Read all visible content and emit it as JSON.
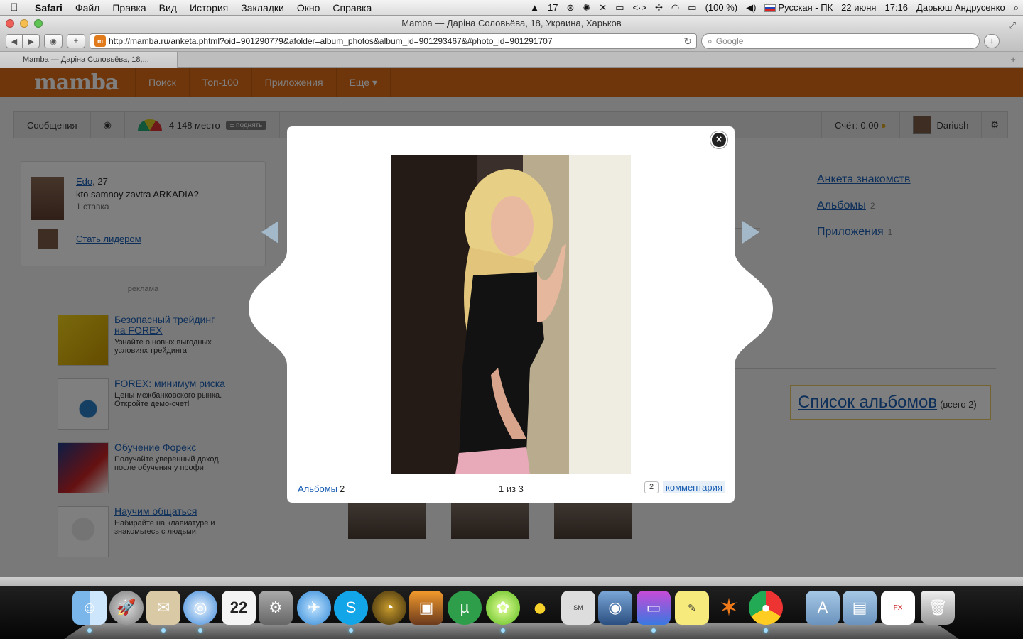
{
  "menubar": {
    "app": "Safari",
    "items": [
      "Файл",
      "Правка",
      "Вид",
      "История",
      "Закладки",
      "Окно",
      "Справка"
    ],
    "status": {
      "calendar_badge": "17",
      "battery": "(100 %)",
      "input_source": "Русская - ПК",
      "date": "22 июня",
      "time": "17:16",
      "user": "Дарьюш Андрусенко"
    }
  },
  "window": {
    "title": "Mamba — Даріна Соловьёва, 18, Украина, Харьков",
    "url": "http://mamba.ru/anketa.phtml?oid=901290779&afolder=album_photos&album_id=901293467&#photo_id=901291707",
    "search_placeholder": "Google",
    "tab_title": "Mamba — Даріна Соловьёва, 18,..."
  },
  "site": {
    "logo": "mamba",
    "nav": [
      "Поиск",
      "Топ-100",
      "Приложения",
      "Еще ▾"
    ],
    "userbar": {
      "messages": "Сообщения",
      "rank": "4 148 место",
      "raise": "± поднять",
      "balance": "Счёт: 0.00",
      "username": "Dariush"
    },
    "leader": {
      "name": "Edo",
      "age": ", 27",
      "text": "kto samnoy zavtra ARKADİA?",
      "bets": "1 ставка",
      "cta": "Стать лидером"
    },
    "ads_label": "реклама",
    "ads": [
      {
        "title": "Безопасный трейдинг на FOREX",
        "desc": "Узнайте о новых выгодных условиях трейдинга"
      },
      {
        "title": "FOREX: минимум риска",
        "desc": "Цены межбанковского рынка. Откройте демо-счет!"
      },
      {
        "title": "Обучение Форекс",
        "desc": "Получайте уверенный доход после обучения у профи"
      },
      {
        "title": "Научим общаться",
        "desc": "Набирайте на клавиатуре и знакомьтесь с людьми."
      }
    ],
    "right_links": [
      {
        "label": "Анкета знакомств",
        "count": ""
      },
      {
        "label": "Альбомы",
        "count": "2"
      },
      {
        "label": "Приложения",
        "count": "1"
      }
    ],
    "album_list": {
      "label": "Список альбомов",
      "total": "(всего 2)"
    }
  },
  "modal": {
    "albums_label": "Альбомы",
    "albums_count": "2",
    "counter": "1 из 3",
    "comments_count": "2",
    "comments_label": "комментария"
  },
  "dock": {
    "items": [
      "finder-icon",
      "launchpad-icon",
      "mail-icon",
      "safari-icon",
      "ical-icon",
      "system-preferences-icon",
      "mail-bird-icon",
      "skype-icon",
      "radar-icon",
      "iphoto-icon",
      "utorrent-icon",
      "icq-icon",
      "adium-icon",
      "solution-menu-icon",
      "facetime-icon",
      "imac-icon",
      "stickies-icon",
      "avast-icon",
      "chrome-icon",
      "applications-folder-icon",
      "documents-folder-icon",
      "forex-app-icon",
      "trash-icon"
    ]
  },
  "colors": {
    "mamba_orange": "#e06d17",
    "link_blue": "#1a5fb4",
    "arrow": "#a3b9c9",
    "album_border": "#e8c865"
  }
}
